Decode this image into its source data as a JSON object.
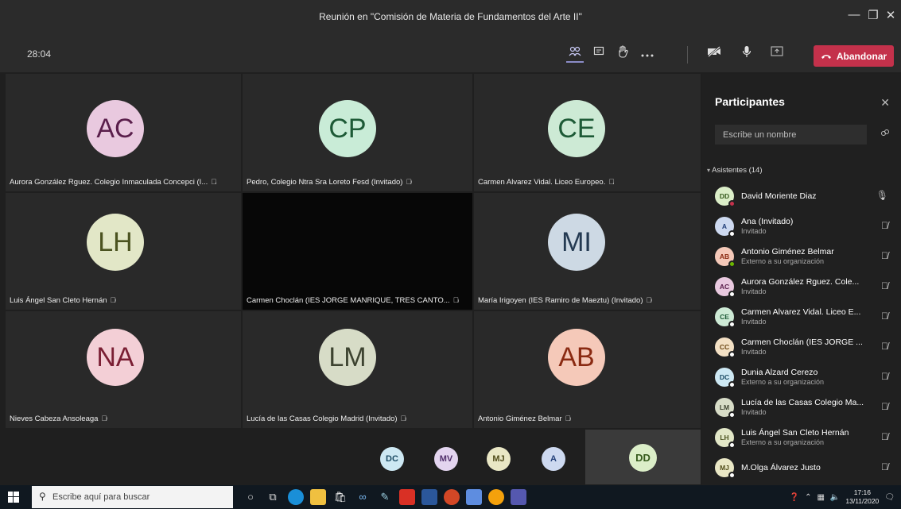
{
  "window": {
    "title": "Reunión en \"Comisión de Materia de Fundamentos del Arte II\"",
    "controls": {
      "minimize": "—",
      "maximize": "❐",
      "close": "✕"
    }
  },
  "toolbar": {
    "timer": "28:04",
    "icons": [
      "participants-icon",
      "chat-icon",
      "raise-hand-icon",
      "more-icon",
      "camera-off-icon",
      "microphone-icon",
      "share-screen-icon"
    ],
    "leave_label": "Abandonar",
    "leave_color": "#c4314b"
  },
  "tiles": [
    {
      "initials": "AC",
      "label": "Aurora González Rguez. Colegio Inmaculada Concepci (I...",
      "bg": "#e9c9df",
      "fg": "#5a1e4b"
    },
    {
      "initials": "CP",
      "label": "Pedro, Colegio Ntra Sra Loreto Fesd (Invitado)",
      "bg": "#c9ecd7",
      "fg": "#1d5a36"
    },
    {
      "initials": "CE",
      "label": "Carmen Alvarez Vidal. Liceo Europeo.",
      "bg": "#cdead5",
      "fg": "#1d5a36"
    },
    {
      "initials": "LH",
      "label": "Luis Ángel San Cleto Hernán",
      "bg": "#e2e7c7",
      "fg": "#4b5320"
    },
    {
      "initials": "",
      "label": "Carmen Choclán (IES JORGE MANRIQUE, TRES CANTO...",
      "bg": "",
      "fg": ""
    },
    {
      "initials": "MI",
      "label": "María Irigoyen (IES Ramiro de Maeztu) (Invitado)",
      "bg": "#cdd9e4",
      "fg": "#243a52"
    },
    {
      "initials": "NA",
      "label": "Nieves Cabeza Ansoleaga",
      "bg": "#f3cfd6",
      "fg": "#7a1e33"
    },
    {
      "initials": "LM",
      "label": "Lucía de las Casas Colegio Madrid (Invitado)",
      "bg": "#d7dcc7",
      "fg": "#3d4330"
    },
    {
      "initials": "AB",
      "label": "Antonio Giménez Belmar",
      "bg": "#f5c9b9",
      "fg": "#8a2a12"
    }
  ],
  "bottom_strip": [
    {
      "initials": "DC",
      "bg": "#cde8f3",
      "fg": "#1b4a63"
    },
    {
      "initials": "MV",
      "bg": "#e3d4ef",
      "fg": "#51306b"
    },
    {
      "initials": "MJ",
      "bg": "#e9e7c5",
      "fg": "#504c1a"
    },
    {
      "initials": "A",
      "bg": "#cdd9f0",
      "fg": "#23407a"
    },
    {
      "initials": "DD",
      "bg": "#dbeec8",
      "fg": "#355a1c"
    }
  ],
  "panel": {
    "title": "Participantes",
    "search_placeholder": "Escribe un nombre",
    "section_label": "Asistentes (14)",
    "participants": [
      {
        "initials": "DD",
        "name": "David Moriente Diaz",
        "sub": "",
        "bg": "#dbeec8",
        "fg": "#355a1c",
        "status": "#c4314b",
        "mic": "on"
      },
      {
        "initials": "A",
        "name": "Ana (Invitado)",
        "sub": "Invitado",
        "bg": "#cdd9f0",
        "fg": "#23407a",
        "status": "#ffffff",
        "mic": "off"
      },
      {
        "initials": "AB",
        "name": "Antonio Giménez Belmar",
        "sub": "Externo a su organización",
        "bg": "#f5c9b9",
        "fg": "#8a2a12",
        "status": "#6bb700",
        "mic": "off"
      },
      {
        "initials": "AC",
        "name": "Aurora González Rguez. Cole...",
        "sub": "Invitado",
        "bg": "#e9c9df",
        "fg": "#5a1e4b",
        "status": "#ffffff",
        "mic": "off"
      },
      {
        "initials": "CE",
        "name": "Carmen Alvarez Vidal. Liceo E...",
        "sub": "Invitado",
        "bg": "#cdead5",
        "fg": "#1d5a36",
        "status": "#ffffff",
        "mic": "off"
      },
      {
        "initials": "CC",
        "name": "Carmen Choclán (IES JORGE ...",
        "sub": "Invitado",
        "bg": "#f3e0c4",
        "fg": "#6a4512",
        "status": "#ffffff",
        "mic": "off"
      },
      {
        "initials": "DC",
        "name": "Dunia Alzard Cerezo",
        "sub": "Externo a su organización",
        "bg": "#cde8f3",
        "fg": "#1b4a63",
        "status": "#ffffff",
        "mic": "off"
      },
      {
        "initials": "LM",
        "name": "Lucía de las Casas Colegio Ma...",
        "sub": "Invitado",
        "bg": "#d7dcc7",
        "fg": "#3d4330",
        "status": "#ffffff",
        "mic": "off"
      },
      {
        "initials": "LH",
        "name": "Luis Ángel San Cleto Hernán",
        "sub": "Externo a su organización",
        "bg": "#e2e7c7",
        "fg": "#4b5320",
        "status": "#ffffff",
        "mic": "off"
      },
      {
        "initials": "MJ",
        "name": "M.Olga Álvarez Justo",
        "sub": "",
        "bg": "#e9e7c5",
        "fg": "#504c1a",
        "status": "#ffffff",
        "mic": "off"
      }
    ]
  },
  "taskbar": {
    "search_placeholder": "Escribe aquí para buscar",
    "time": "17:16",
    "date": "13/11/2020"
  }
}
